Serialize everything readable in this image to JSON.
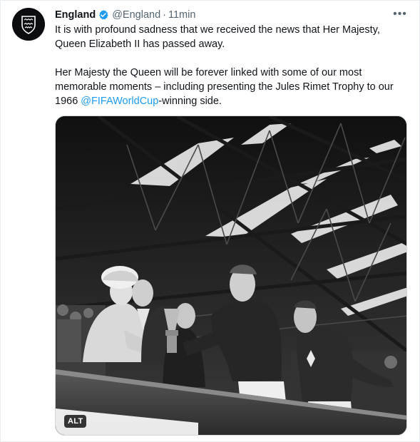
{
  "tweet": {
    "display_name": "England",
    "handle": "@England",
    "separator": "·",
    "time": "11min",
    "more_label": "•••",
    "paragraph1": "It is with profound sadness that we received the news that Her Majesty, Queen Elizabeth II has passed away.",
    "paragraph2_start": "Her Majesty the Queen will be forever linked with some of our most memorable moments – including presenting the Jules Rimet Trophy to our 1966 ",
    "mention": "@FIFAWorldCup",
    "paragraph2_end": "-winning side."
  },
  "media": {
    "alt_badge": "ALT",
    "style": "black-and-white photograph"
  },
  "colors": {
    "link": "#1d9bf0",
    "verified": "#1d9bf0",
    "secondary_text": "#536471",
    "avatar_bg": "#0c0d10"
  },
  "icons": [
    "england-crest-icon",
    "verified-badge-icon",
    "more-options-icon"
  ]
}
